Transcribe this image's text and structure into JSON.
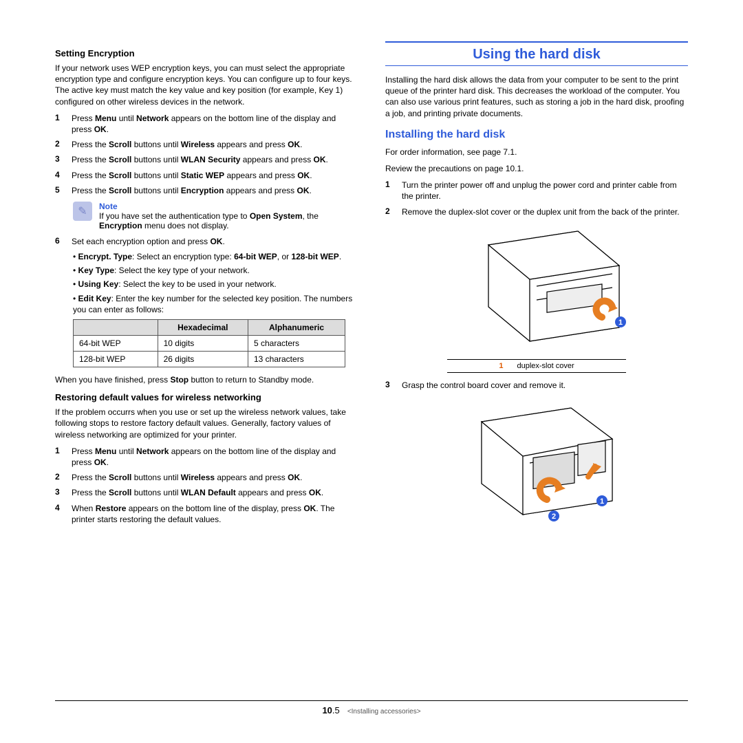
{
  "left": {
    "h1": "Setting Encryption",
    "intro": "If your network uses WEP encryption keys, you can must select the appropriate encryption type and configure encryption keys. You can configure up to four keys. The active key must match the key value and key position (for example, Key 1) configured on other wireless devices in the network.",
    "s1_a": "Press ",
    "s1_b": "Menu",
    "s1_c": " until ",
    "s1_d": "Network",
    "s1_e": " appears on the bottom line of the display and press ",
    "s1_f": "OK",
    "s1_g": ".",
    "s2_a": "Press the ",
    "s2_b": "Scroll",
    "s2_c": " buttons until ",
    "s2_d": "Wireless",
    "s2_e": " appears and press ",
    "s2_f": "OK",
    "s2_g": ".",
    "s3_a": "Press the ",
    "s3_b": "Scroll",
    "s3_c": " buttons until ",
    "s3_d": "WLAN Security",
    "s3_e": " appears and press ",
    "s3_f": "OK",
    "s3_g": ".",
    "s4_a": "Press the ",
    "s4_b": "Scroll",
    "s4_c": " buttons until ",
    "s4_d": "Static WEP",
    "s4_e": " appears and press ",
    "s4_f": "OK",
    "s4_g": ".",
    "s5_a": "Press the ",
    "s5_b": "Scroll",
    "s5_c": " buttons until ",
    "s5_d": "Encryption",
    "s5_e": " appears and press ",
    "s5_f": "OK",
    "s5_g": ".",
    "note_label": "Note",
    "note_a": "If you have set the authentication type to ",
    "note_b": "Open System",
    "note_c": ", the ",
    "note_d": "Encryption",
    "note_e": " menu does not display.",
    "s6_a": "Set each encryption option and press ",
    "s6_b": "OK",
    "s6_c": ".",
    "b1_a": "• ",
    "b1_b": "Encrypt. Type",
    "b1_c": ": Select an encryption type: ",
    "b1_d": "64-bit WEP",
    "b1_e": ", or ",
    "b1_f": "128-bit WEP",
    "b1_g": ".",
    "b2_a": "• ",
    "b2_b": "Key Type",
    "b2_c": ": Select the key type of your network.",
    "b3_a": "• ",
    "b3_b": "Using Key",
    "b3_c": ": Select the key to be used in your network.",
    "b4_a": "• ",
    "b4_b": "Edit Key",
    "b4_c": ": Enter the key number for the selected key position. The numbers you can enter as follows:",
    "th1": "",
    "th2": "Hexadecimal",
    "th3": "Alphanumeric",
    "r1c1": "64-bit WEP",
    "r1c2": "10 digits",
    "r1c3": "5 characters",
    "r2c1": "128-bit WEP",
    "r2c2": "26 digits",
    "r2c3": "13 characters",
    "after_a": "When you have finished, press ",
    "after_b": "Stop",
    "after_c": " button to return to Standby mode.",
    "h2": "Restoring default values for wireless networking",
    "intro2": "If the problem occurrs when you use or set up the wireless network values, take following stops to restore factory default values. Generally, factory values of wireless networking are optimized for your printer.",
    "q1_a": "Press ",
    "q1_b": "Menu",
    "q1_c": " until ",
    "q1_d": "Network",
    "q1_e": " appears on the bottom line of the display and press ",
    "q1_f": "OK",
    "q1_g": ".",
    "q2_a": "Press the ",
    "q2_b": "Scroll",
    "q2_c": " buttons until ",
    "q2_d": "Wireless",
    "q2_e": " appears and press ",
    "q2_f": "OK",
    "q2_g": ".",
    "q3_a": "Press the ",
    "q3_b": "Scroll",
    "q3_c": " buttons until ",
    "q3_d": "WLAN Default",
    "q3_e": " appears and press ",
    "q3_f": "OK",
    "q3_g": ".",
    "q4_a": "When  ",
    "q4_b": "Restore",
    "q4_c": " appears on the bottom line of the display, press ",
    "q4_d": "OK",
    "q4_e": ". The printer starts restoring the default values."
  },
  "right": {
    "title": "Using the hard disk",
    "intro": "Installing the hard disk allows the data from your computer to be sent to the print queue of the printer hard disk. This decreases the workload of the computer. You can also use various print features, such as storing a job in the hard disk, proofing a job, and printing private documents.",
    "sub": "Installing the hard disk",
    "p1": "For order information, see page 7.1.",
    "p2": "Review the precautions on page 10.1.",
    "s1": "Turn the printer power off and unplug the power cord and printer cable from the printer.",
    "s2": "Remove the duplex-slot cover or the duplex unit from the back of the printer.",
    "label_n": "1",
    "label_t": "duplex-slot cover",
    "s3": "Grasp the control board cover and remove it."
  },
  "footer": {
    "chapter": "10",
    "page": ".5",
    "crumb": "<Installing accessories>"
  }
}
